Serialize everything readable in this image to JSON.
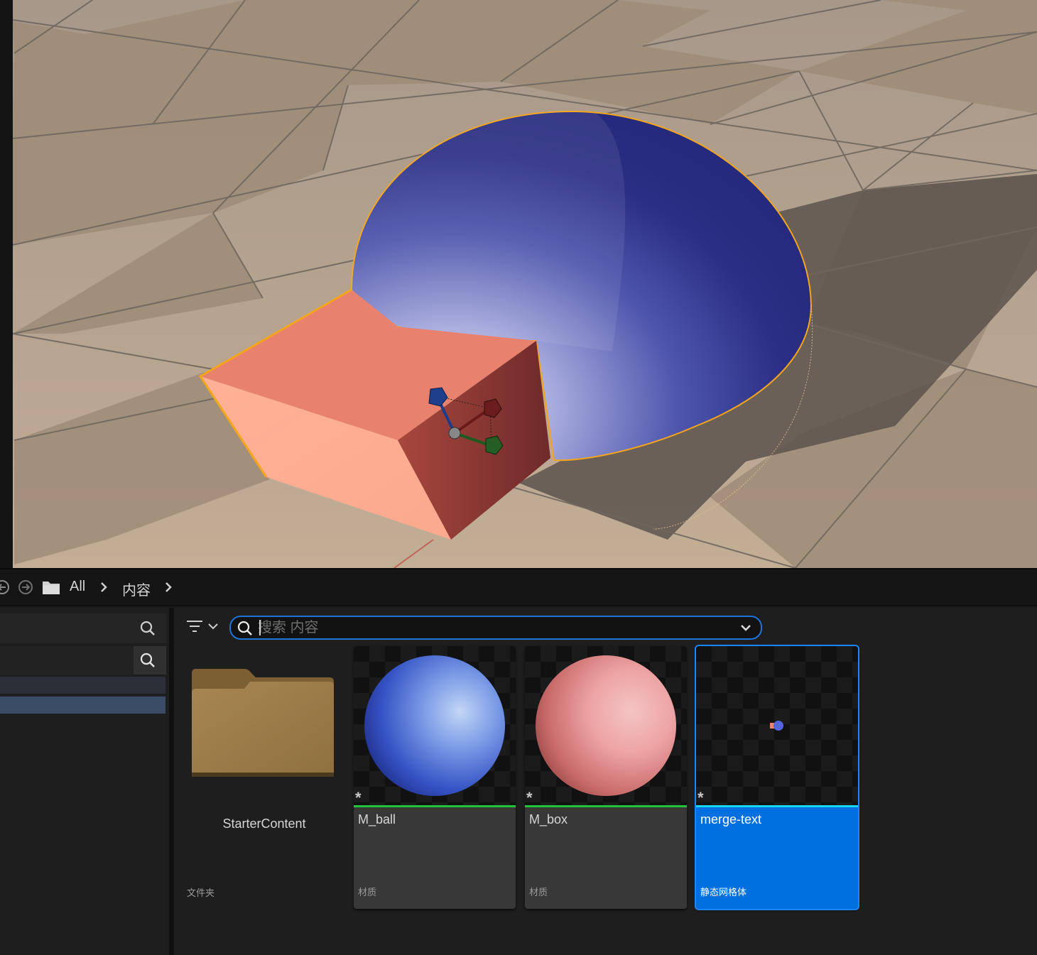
{
  "breadcrumb": {
    "items": [
      "All",
      "内容"
    ]
  },
  "search": {
    "placeholder": "搜索 内容"
  },
  "assets": [
    {
      "name": "StarterContent",
      "type": "文件夹"
    },
    {
      "name": "M_ball",
      "type": "材质"
    },
    {
      "name": "M_box",
      "type": "材质"
    },
    {
      "name": "merge-text",
      "type": "静态网格体"
    }
  ],
  "colors": {
    "accent": "#0070e0",
    "material_bar": "#22c33a",
    "mesh_bar": "#16d6f0",
    "box": "#e88470",
    "sphere": "#2a2f8a",
    "folder": "#a27f4a"
  }
}
